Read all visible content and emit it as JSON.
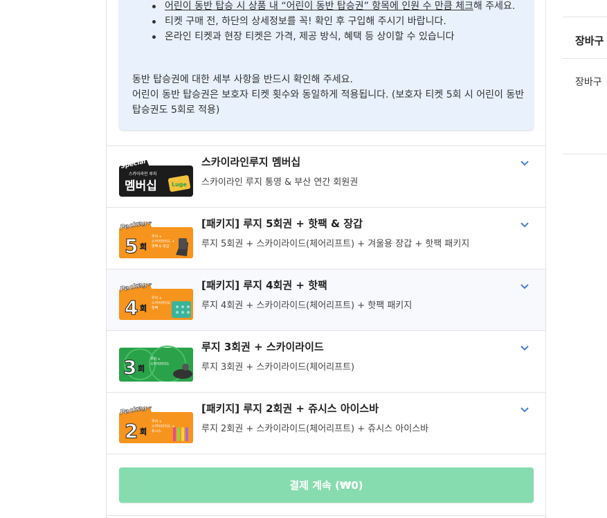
{
  "notice": {
    "bullets": [
      {
        "pre": "",
        "u1": "어린이 동반 탑승 시 상품 내 “어린이 동반 탑승권” 항목에 인원 수 만큼 체크",
        "post": "해 주세요."
      },
      {
        "pre": "티켓 구매 전, 하단의 상세정보를 꼭! 확인 후 구입해 주시기 바랍니다.",
        "u1": "",
        "post": ""
      },
      {
        "pre": "온라인 티켓과 현장 티켓은 가격, 제공 방식, 혜택 등 상이할 수 있습니다",
        "u1": "",
        "post": ""
      }
    ],
    "para1": "동반 탑승권에 대한 세부 사항을 반드시 확인해 주세요.",
    "para2": "어린이 동반 탑승권은 보호자 티켓 횟수와 동일하게 적용됩니다. (보호자 티켓 5회 시 어린이 동반 탑승권도 5회로 적용)"
  },
  "products": [
    {
      "title": "스카이라인루지 멤버십",
      "desc": "스카이라인 루지 통영 & 부산 연간 회원권",
      "badge_top": "Special",
      "badge_sub": "스카이라인 루지",
      "badge_main": "멤버십",
      "card_text": "Luge"
    },
    {
      "title": "[패키지] 루지 5회권 + 핫팩 & 장갑",
      "desc": "루지 5회권 + 스카이라이드(체어리프트) + 겨울용 장갑 + 핫팩 패키지",
      "badge_top": "Package",
      "badge_main": "5",
      "badge_unit": "회",
      "badge_lines": [
        "루지 +",
        "스카이라이드 +",
        "핫팩 & 장갑"
      ]
    },
    {
      "title": "[패키지] 루지 4회권 + 핫팩",
      "desc": "루지 4회권 + 스카이라이드(체어리프트) + 핫팩 패키지",
      "badge_top": "Package",
      "badge_main": "4",
      "badge_unit": "회",
      "badge_lines": [
        "루지 +",
        "스카이라이드 +",
        "핫팩"
      ]
    },
    {
      "title": "루지 3회권 + 스카이라이드",
      "desc": "루지 3회권 + 스카이라이드(체어리프트)",
      "badge_main": "3",
      "badge_unit": "회",
      "badge_lines": [
        "루지 +",
        "스카이라이드"
      ]
    },
    {
      "title": "[패키지] 루지 2회권 + 쥬시스 아이스바",
      "desc": "루지 2회권 + 스카이라이드(체어리프트) + 쥬시스 아이스바",
      "badge_top": "Package",
      "badge_main": "2",
      "badge_unit": "회",
      "badge_lines": [
        "루지 +",
        "스카이라이드 +",
        "쥬시스"
      ]
    }
  ],
  "pay_button": "결제 계속 (₩0)",
  "side": {
    "title": "장바구",
    "text": "장바구"
  },
  "colors": {
    "accent": "#3d7fd6",
    "pay": "#86dcae",
    "notice_bg": "#e8f1fc",
    "orange": "#f7941d",
    "green": "#2aa24a"
  }
}
